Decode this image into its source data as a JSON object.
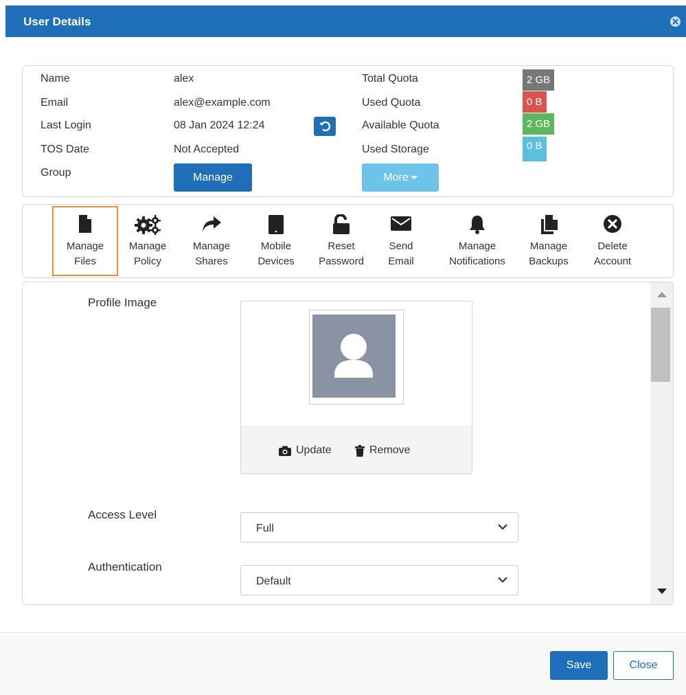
{
  "dialog": {
    "title": "User Details"
  },
  "info": {
    "name_label": "Name",
    "name_value": "alex",
    "email_label": "Email",
    "email_value": "alex@example.com",
    "last_login_label": "Last Login",
    "last_login_value": "08 Jan 2024 12:24",
    "tos_label": "TOS Date",
    "tos_value": "Not Accepted",
    "group_label": "Group",
    "group_button": "Manage",
    "total_quota_label": "Total Quota",
    "total_quota_value": "2 GB",
    "used_quota_label": "Used Quota",
    "used_quota_value": "0 B",
    "available_quota_label": "Available Quota",
    "available_quota_value": "2 GB",
    "used_storage_label": "Used Storage",
    "used_storage_value": "0 B",
    "more_button": "More"
  },
  "toolbar": {
    "items": [
      {
        "label1": "Manage",
        "label2": "Files",
        "icon": "file-icon",
        "active": true
      },
      {
        "label1": "Manage",
        "label2": "Policy",
        "icon": "gears-icon"
      },
      {
        "label1": "Manage",
        "label2": "Shares",
        "icon": "share-icon"
      },
      {
        "label1": "Mobile",
        "label2": "Devices",
        "icon": "tablet-icon"
      },
      {
        "label1": "Reset",
        "label2": "Password",
        "icon": "unlock-icon"
      },
      {
        "label1": "Send",
        "label2": "Email",
        "icon": "envelope-icon"
      },
      {
        "label1": "Manage",
        "label2": "Notifications",
        "icon": "bell-icon"
      },
      {
        "label1": "Manage",
        "label2": "Backups",
        "icon": "files-icon"
      },
      {
        "label1": "Delete",
        "label2": "Account",
        "icon": "delete-circle-icon"
      }
    ]
  },
  "profile": {
    "label": "Profile Image",
    "update": "Update",
    "remove": "Remove"
  },
  "access_level": {
    "label": "Access Level",
    "value": "Full"
  },
  "authentication": {
    "label": "Authentication",
    "value": "Default"
  },
  "footer": {
    "save": "Save",
    "close": "Close"
  },
  "colors": {
    "primary": "#1e6eb8",
    "highlight": "#f08a3c"
  }
}
